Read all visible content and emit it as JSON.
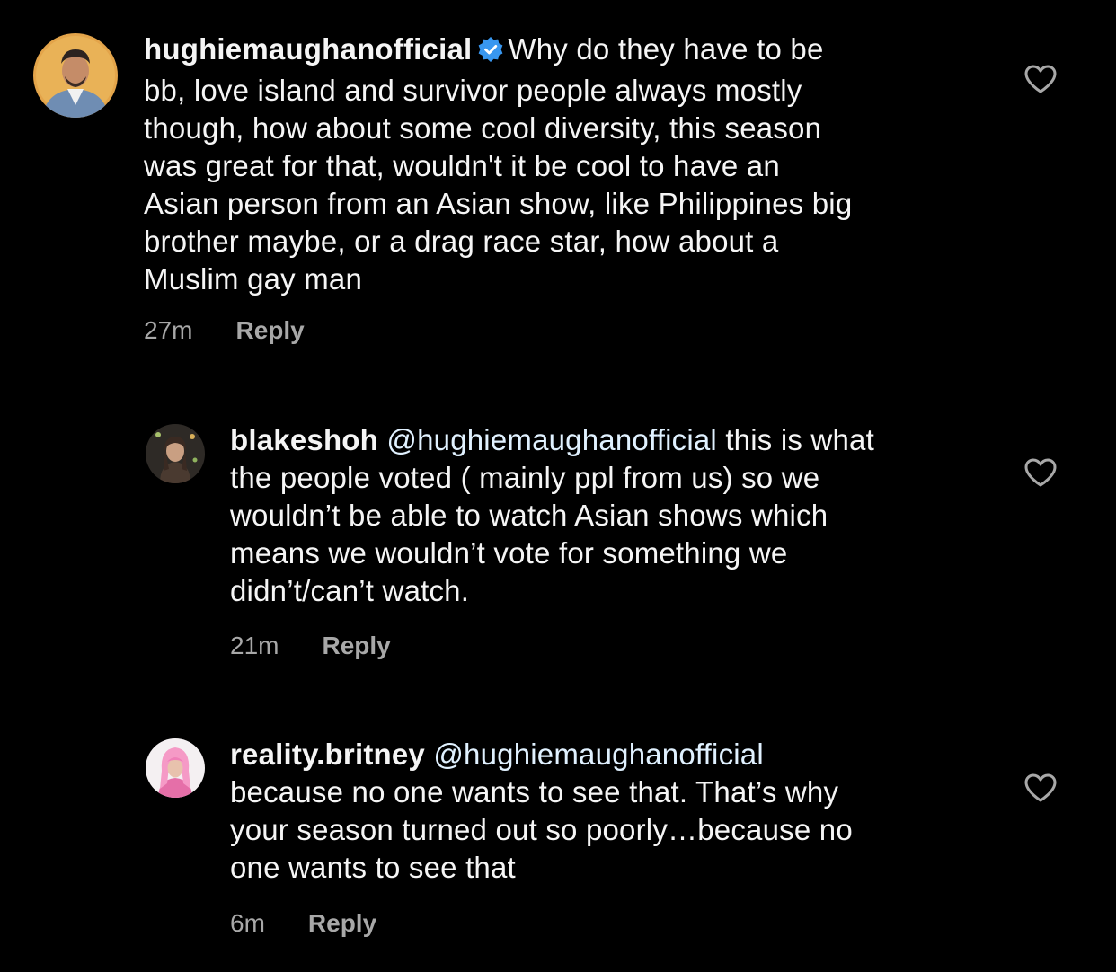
{
  "comments": [
    {
      "username": "hughiemaughanofficial",
      "verified": true,
      "mention": "",
      "lines": [
        "Why do they have to be",
        "bb, love island and survivor people always mostly",
        "though, how about some cool diversity, this season",
        "was great for that, wouldn't it be cool to have an",
        "Asian person from an Asian show, like Philippines big",
        "brother maybe, or a drag race star, how about a",
        "Muslim gay man"
      ],
      "time": "27m",
      "reply_label": "Reply",
      "like_icon": "heart-outline-icon"
    },
    {
      "username": "blakeshoh",
      "verified": false,
      "mention": "@hughiemaughanofficial",
      "lines": [
        "this is what",
        "the people voted ( mainly ppl from us) so we",
        "wouldn’t be able to watch Asian shows which",
        "means we wouldn’t vote for something we",
        "didn’t/can’t watch."
      ],
      "time": "21m",
      "reply_label": "Reply",
      "like_icon": "heart-outline-icon"
    },
    {
      "username": "reality.britney",
      "verified": false,
      "mention": "@hughiemaughanofficial",
      "lines": [
        "",
        "because no one wants to see that. That’s why",
        "your season turned out so poorly…because no",
        "one wants to see that"
      ],
      "time": "6m",
      "reply_label": "Reply",
      "like_icon": "heart-outline-icon"
    }
  ],
  "colors": {
    "background": "#000000",
    "text": "#f5f5f5",
    "meta": "#a8a8a8",
    "verified": "#3897f0"
  }
}
